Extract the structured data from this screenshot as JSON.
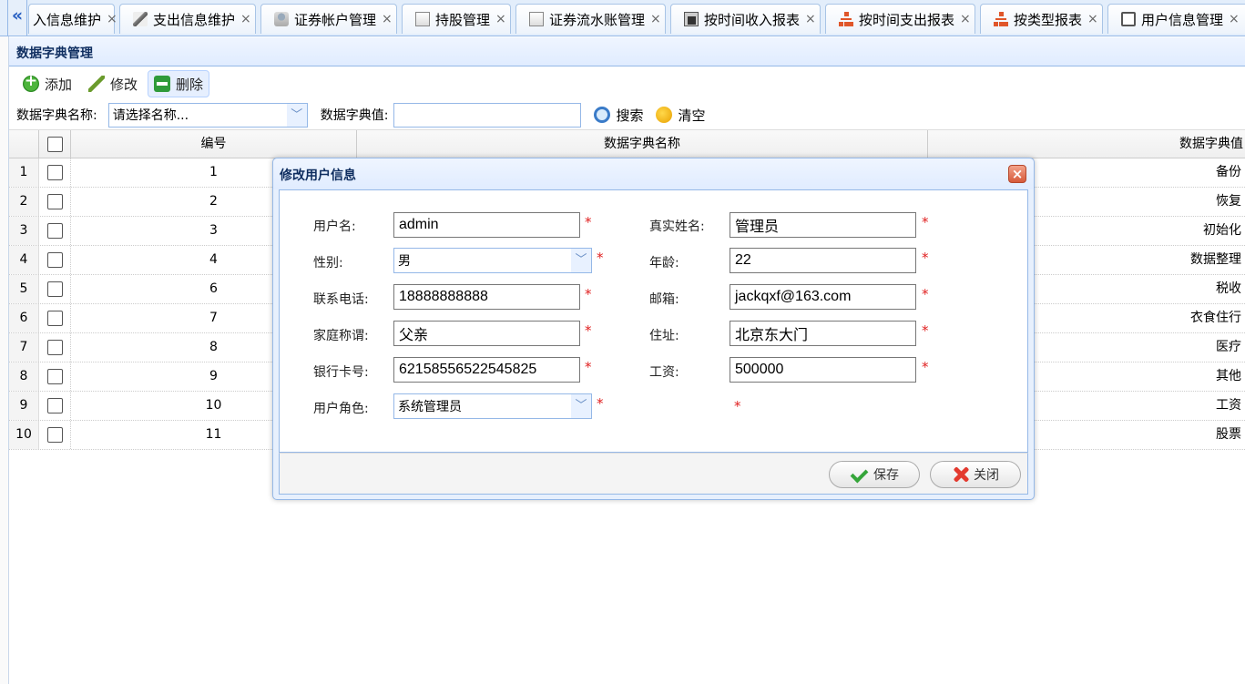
{
  "tabs": [
    {
      "label": "入信息维护",
      "icon": "edit-icon",
      "close": "×"
    },
    {
      "label": "支出信息维护",
      "icon": "edit-icon",
      "close": "×"
    },
    {
      "label": "证券帐户管理",
      "icon": "user-icon",
      "close": "×"
    },
    {
      "label": "持股管理",
      "icon": "doc-icon",
      "close": "×"
    },
    {
      "label": "证券流水账管理",
      "icon": "doc-icon",
      "close": "×"
    },
    {
      "label": "按时间收入报表",
      "icon": "chart-icon",
      "close": "×"
    },
    {
      "label": "按时间支出报表",
      "icon": "org-chart-icon",
      "close": "×"
    },
    {
      "label": "按类型报表",
      "icon": "org-chart-icon",
      "close": "×"
    },
    {
      "label": "用户信息管理",
      "icon": "window-icon",
      "close": "×"
    }
  ],
  "tab_scroll_left": "«",
  "panel": {
    "title": "数据字典管理"
  },
  "toolbar": {
    "add_label": "添加",
    "edit_label": "修改",
    "delete_label": "删除"
  },
  "search": {
    "name_label": "数据字典名称:",
    "name_placeholder": "请选择名称...",
    "value_label": "数据字典值:",
    "value_input": "",
    "search_label": "搜索",
    "clear_label": "清空"
  },
  "grid": {
    "columns": [
      "编号",
      "数据字典名称",
      "数据字典值"
    ],
    "rows": [
      {
        "num": "1",
        "id": "1",
        "value": "备份"
      },
      {
        "num": "2",
        "id": "2",
        "value": "恢复"
      },
      {
        "num": "3",
        "id": "3",
        "value": "初始化"
      },
      {
        "num": "4",
        "id": "4",
        "value": "数据整理"
      },
      {
        "num": "5",
        "id": "6",
        "value": "税收"
      },
      {
        "num": "6",
        "id": "7",
        "value": "衣食住行"
      },
      {
        "num": "7",
        "id": "8",
        "value": "医疗"
      },
      {
        "num": "8",
        "id": "9",
        "value": "其他"
      },
      {
        "num": "9",
        "id": "10",
        "value": "工资"
      },
      {
        "num": "10",
        "id": "11",
        "value": "股票"
      }
    ]
  },
  "dialog": {
    "title": "修改用户信息",
    "close": "×",
    "required_mark": "*",
    "fields": {
      "username": {
        "label": "用户名:",
        "value": "admin"
      },
      "realname": {
        "label": "真实姓名:",
        "value": "管理员"
      },
      "gender": {
        "label": "性别:",
        "value": "男"
      },
      "age": {
        "label": "年龄:",
        "value": "22"
      },
      "phone": {
        "label": "联系电话:",
        "value": "18888888888"
      },
      "email": {
        "label": "邮箱:",
        "value": "jackqxf@163.com"
      },
      "relation": {
        "label": "家庭称谓:",
        "value": "父亲"
      },
      "address": {
        "label": "住址:",
        "value": "北京东大门"
      },
      "bankcard": {
        "label": "银行卡号:",
        "value": "62158556522545825"
      },
      "salary": {
        "label": "工资:",
        "value": "500000"
      },
      "role": {
        "label": "用户角色:",
        "value": "系统管理员"
      }
    },
    "save_label": "保存",
    "close_label": "关闭"
  },
  "colors": {
    "accent": "#95b8e7",
    "required": "#e02020",
    "header_text": "#0e2d5f"
  }
}
